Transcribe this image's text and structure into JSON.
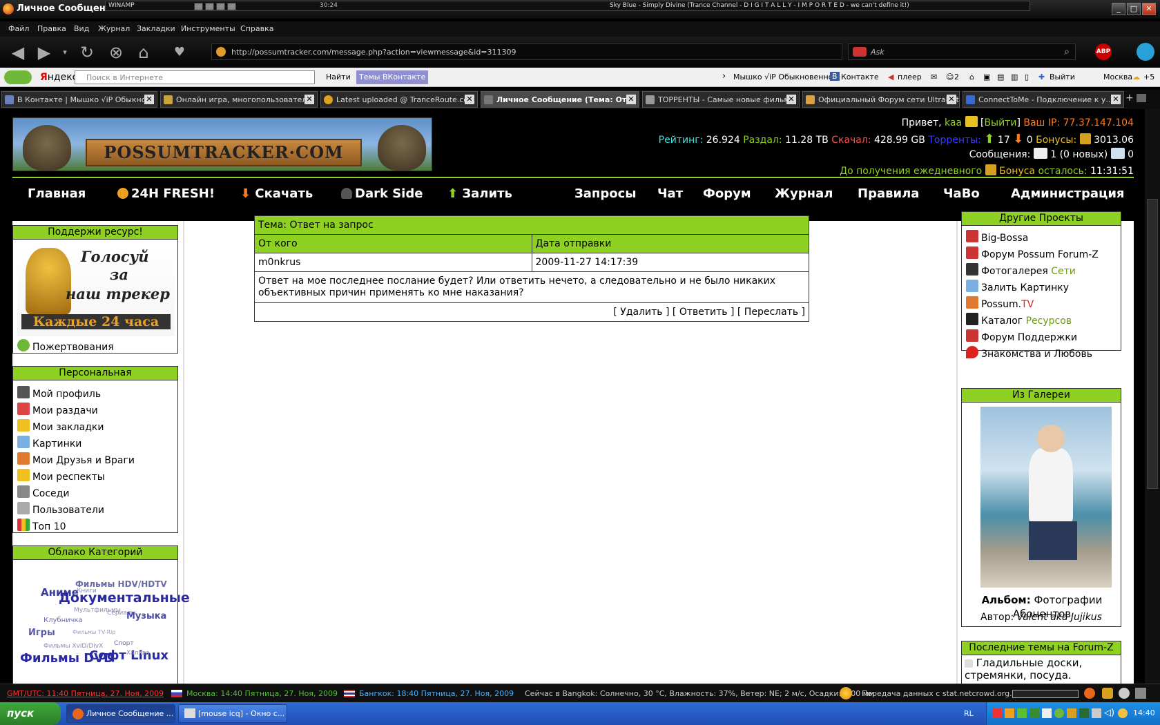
{
  "window": {
    "title": "Личное Сообщение"
  },
  "winamp": {
    "label": "WINAMP",
    "time": "30:24",
    "song": "Sky Blue - Simply Divine (Trance Channel - D I G I T A L L Y - I M P O R T E D - we can't define it!)"
  },
  "menu": [
    "Файл",
    "Правка",
    "Вид",
    "Журнал",
    "Закладки",
    "Инструменты",
    "Справка"
  ],
  "address": {
    "url": "http://possumtracker.com/message.php?action=viewmessage&id=311309"
  },
  "search": {
    "placeholder": "Ask"
  },
  "yandex": {
    "logo_first": "Я",
    "logo_rest": "ндекс",
    "placeholder": "Поиск в Интернете",
    "find": "Найти",
    "vk_themes": "Темы ВКонтакте",
    "user": "Мышко √iP Обыкновенное",
    "vk": "Контакте",
    "player": "плеер",
    "mail_count": "2",
    "logout": "Выйти",
    "weather": "Москва",
    "temp": "+5"
  },
  "tabs": [
    {
      "label": "В Контакте | Мышко √iP Обыкно..."
    },
    {
      "label": "Онлайн игра, многопользовател..."
    },
    {
      "label": "Latest uploaded @ TranceRoute.co..."
    },
    {
      "label": "Личное Сообщение (Тема: От..."
    },
    {
      "label": "ТОРРЕНТЫ - Самые новые фильм..."
    },
    {
      "label": "Официальный Форум сети UltraNet"
    },
    {
      "label": "ConnectToMe - Подключение к у..."
    }
  ],
  "header": {
    "logo_text": "POSSUMTRACKER·COM",
    "greeting": "Привет,",
    "username": "kaa",
    "logout": "Выйти",
    "ip_label": "Ваш IP:",
    "ip": "77.37.147.104",
    "rating_label": "Рейтинг:",
    "rating": "26.924",
    "upload_label": "Раздал:",
    "upload": "11.28 TB",
    "download_label": "Скачал:",
    "download": "428.99 GB",
    "torrents_label": "Торренты:",
    "seeding": "17",
    "leeching": "0",
    "bonus_label": "Бонусы:",
    "bonus": "3013.06",
    "messages_label": "Сообщения:",
    "messages": "1 (0 новых)",
    "sent": "0",
    "daily_pre": "До получения ежедневного",
    "daily_bonus": "Бонуса",
    "daily_post": "осталось:",
    "daily_time": "11:31:51"
  },
  "nav": [
    "Главная",
    "24H FRESH!",
    "Скачать",
    "Dark Side",
    "Залить",
    "Запросы",
    "Чат",
    "Форум",
    "Журнал",
    "Правила",
    "ЧаВо",
    "Администрация"
  ],
  "left": {
    "support_title": "Поддержи ресурс!",
    "vote_line1": "Голосуй",
    "vote_line2": "за",
    "vote_line3": "наш трекер",
    "vote_line4": "Каждые 24 часа",
    "donate": "Пожертвования",
    "personal_title": "Персональная",
    "personal": [
      "Мой профиль",
      "Мои раздачи",
      "Мои закладки",
      "Картинки",
      "Мои Друзья и Враги",
      "Мои респекты",
      "Соседи",
      "Пользователи",
      "Топ 10"
    ],
    "cloud_title": "Облако Категорий",
    "cloud": [
      "Фильмы HDV/HDTV",
      "Аниме",
      "Книги",
      "Документальные",
      "Мультфильмы",
      "Клубничка",
      "Сериалы",
      "Музыка",
      "Игры",
      "Фильмы TV-Rip",
      "Фильмы XviD/DivX",
      "Спорт",
      "Фильмы DVD",
      "Софт Linux",
      "Халява"
    ]
  },
  "message": {
    "subject_label": "Тема:",
    "subject": "Ответ на запрос",
    "from_header": "От кого",
    "date_header": "Дата отправки",
    "from": "m0nkrus",
    "date": "2009-11-27 14:17:39",
    "body": "Ответ на мое последнее послание будет? Или ответить нечето, а следовательно и не было никаких объективных причин применять ко мне наказания?",
    "delete": "Удалить",
    "reply": "Ответить",
    "forward": "Переслать"
  },
  "right": {
    "projects_title": "Другие Проекты",
    "projects": [
      {
        "main": "Big-Bossa",
        "accent": ""
      },
      {
        "main": "Форум Possum Forum-Z",
        "accent": ""
      },
      {
        "main": "Фотогалерея ",
        "accent": "Сети"
      },
      {
        "main": "Залить Картинку",
        "accent": ""
      },
      {
        "main": "Possum.",
        "accent": "TV"
      },
      {
        "main": "Каталог ",
        "accent": "Ресурсов"
      },
      {
        "main": "Форум Поддержки",
        "accent": ""
      },
      {
        "main": "Знакомства и Любовь",
        "accent": ""
      }
    ],
    "gallery_title": "Из Галереи",
    "album_label": "Альбом:",
    "album": "Фотографии Абонентов",
    "author_label": "Автор:",
    "author": "Valent aka Jujikus",
    "forum_title": "Последние темы на Forum-Z",
    "forum_item": "Гладильные доски, стремянки, посуда."
  },
  "status": {
    "utc": "GMT/UTC: 11:40 Пятница, 27. Ноя, 2009",
    "moscow": "Москва: 14:40 Пятница, 27. Ноя, 2009",
    "bangkok": "Бангкок: 18:40 Пятница, 27. Ноя, 2009",
    "weather": "Сейчас в Bangkok: Солнечно, 30 °C, Влажность: 37%, Ветер: NE; 2 м/с, Осадки: 0.00 мм",
    "transfer": "Передача данных с stat.netcrowd.org..."
  },
  "taskbar": {
    "start": "пуск",
    "btn1": "Личное Сообщение ...",
    "btn2": "[mouse icq] - Окно с...",
    "lang": "RL",
    "clock": "14:40"
  },
  "colors": {
    "accent": "#8fd122",
    "header_bg": "#000000"
  }
}
